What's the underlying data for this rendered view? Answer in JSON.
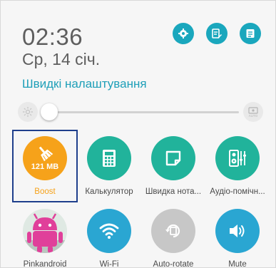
{
  "status": {
    "time": "02:36",
    "date": "Ср, 14 січ."
  },
  "header": {
    "title": "Швидкі налаштування",
    "buttons": [
      {
        "icon": "gear-icon"
      },
      {
        "icon": "edit-icon"
      },
      {
        "icon": "notes-icon"
      }
    ]
  },
  "brightness": {
    "auto_label": "AUTO",
    "level": 0.02
  },
  "tiles_row1": [
    {
      "label": "Boost",
      "value": "121 MB",
      "icon": "broom-icon",
      "color": "#f6a21a",
      "label_color": "#f6a21a"
    },
    {
      "label": "Калькулятор",
      "icon": "calculator-icon",
      "color": "#21b39b"
    },
    {
      "label": "Швидка нота...",
      "icon": "quick-memo-icon",
      "color": "#21b39b"
    },
    {
      "label": "Аудіо-помічн...",
      "icon": "audio-wizard-icon",
      "color": "#21b39b"
    }
  ],
  "tiles_row2": [
    {
      "label": "Pinkandroid",
      "icon": "avatar-icon"
    },
    {
      "label": "Wi-Fi",
      "icon": "wifi-icon",
      "color": "#2aa6d2"
    },
    {
      "label": "Auto-rotate",
      "icon": "auto-rotate-icon",
      "color": "#c7c7c7"
    },
    {
      "label": "Mute",
      "icon": "speaker-icon",
      "color": "#2aa6d2"
    }
  ]
}
